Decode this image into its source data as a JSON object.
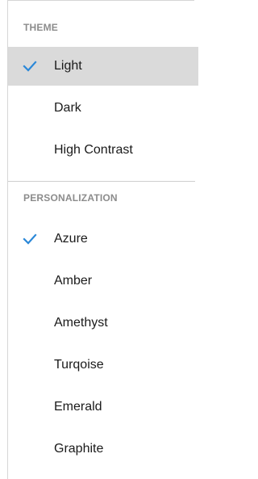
{
  "theme_section": {
    "header": "THEME",
    "items": [
      {
        "label": "Light",
        "checked": true,
        "selected": true
      },
      {
        "label": "Dark",
        "checked": false,
        "selected": false
      },
      {
        "label": "High Contrast",
        "checked": false,
        "selected": false
      }
    ]
  },
  "personalization_section": {
    "header": "PERSONALIZATION",
    "items": [
      {
        "label": "Azure",
        "checked": true
      },
      {
        "label": "Amber",
        "checked": false
      },
      {
        "label": "Amethyst",
        "checked": false
      },
      {
        "label": "Turqoise",
        "checked": false
      },
      {
        "label": "Emerald",
        "checked": false
      },
      {
        "label": "Graphite",
        "checked": false
      }
    ]
  },
  "colors": {
    "check": "#2b88d8",
    "selected_background": "#dadada",
    "header_text": "#8c8c8c"
  }
}
